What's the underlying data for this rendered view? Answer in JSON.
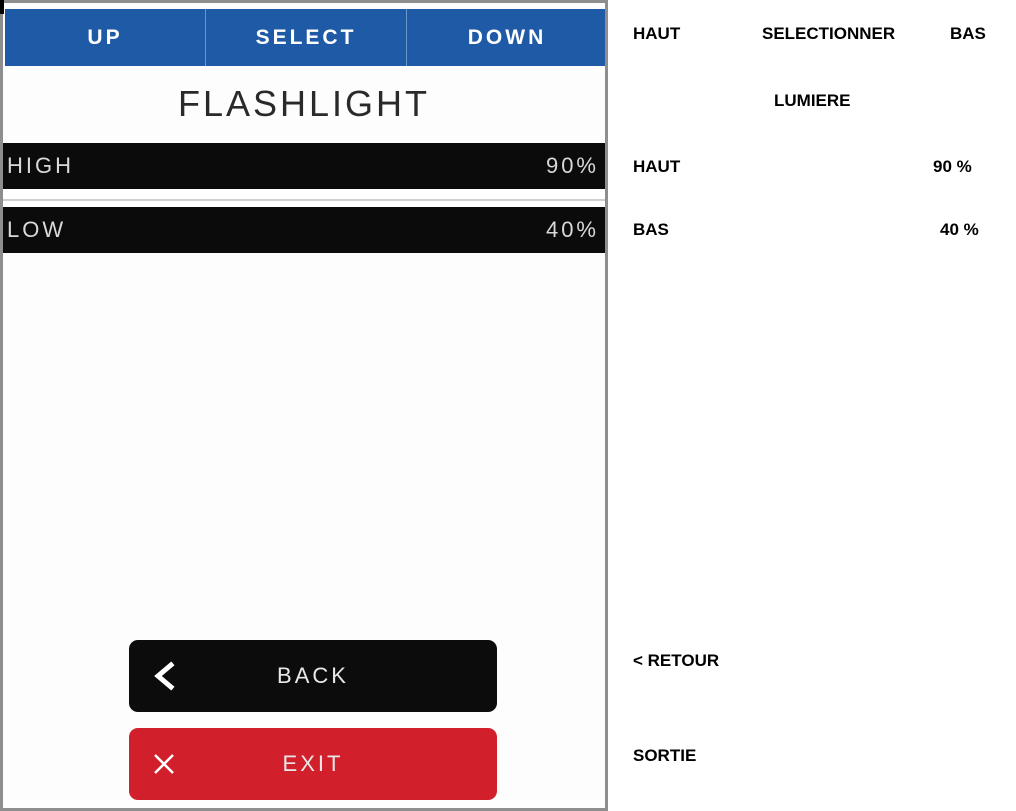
{
  "device": {
    "topbar": {
      "up_label": "UP",
      "select_label": "SELECT",
      "down_label": "DOWN"
    },
    "title": "FLASHLIGHT",
    "options": [
      {
        "label": "HIGH",
        "value": "90%"
      },
      {
        "label": "LOW",
        "value": "40%"
      }
    ],
    "back_label": "BACK",
    "exit_label": "EXIT",
    "colors": {
      "topbar": "#1f5aa6",
      "option_bg": "#0b0b0b",
      "back_bg": "#0c0c0c",
      "exit_bg": "#d21f2c"
    },
    "icons": {
      "back": "chevron-left-icon",
      "exit": "close-icon"
    }
  },
  "translations": {
    "up": "HAUT",
    "select": "SELECTIONNER",
    "down": "BAS",
    "title": "LUMIERE",
    "high_label": "HAUT",
    "high_value": "90 %",
    "low_label": "BAS",
    "low_value": "40 %",
    "back": "< RETOUR",
    "exit": "SORTIE"
  }
}
